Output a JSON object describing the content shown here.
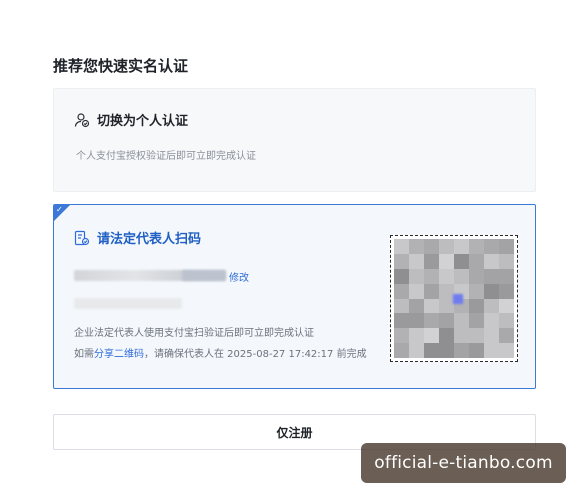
{
  "page": {
    "title": "推荐您快速实名认证"
  },
  "personal_card": {
    "title": "切换为个人认证",
    "description": "个人支付宝授权验证后即可立即完成认证",
    "icon": "person-verify-icon"
  },
  "legal_card": {
    "title": "请法定代表人扫码",
    "icon": "document-verify-icon",
    "selected": true,
    "modify_label": "修改",
    "description": "企业法定代表人使用支付宝扫验证后即可立即完成认证",
    "share_prefix": "如需",
    "share_link": "分享二维码",
    "share_suffix": "，请确保代表人在 2025-08-27 17:42:17 前完成",
    "qr_icon": "qr-code-icon"
  },
  "register_button": {
    "label": "仅注册"
  },
  "watermark": {
    "text": "official-e-tianbo.com"
  },
  "colors": {
    "accent": "#3c78d8",
    "link": "#2f6bd8",
    "selected_bg": "#f4f8fd",
    "card_bg": "#f7f8fa"
  }
}
